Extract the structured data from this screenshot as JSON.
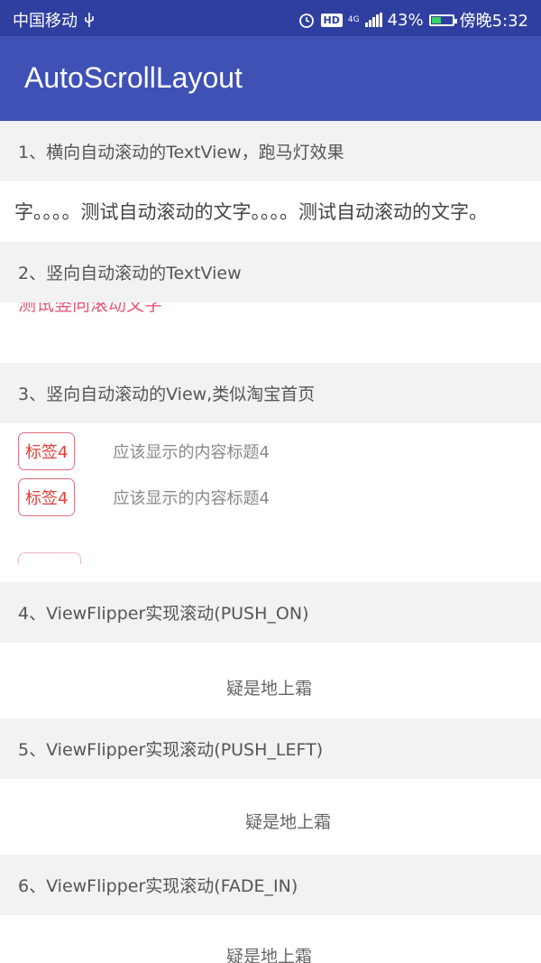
{
  "status_bar": {
    "carrier": "中国移动",
    "network": "4G",
    "battery": "43%",
    "time": "傍晚5:32",
    "battery_level": 0.43,
    "icons": [
      "usb-icon",
      "alarm-icon",
      "hd-icon",
      "signal-icon",
      "battery-icon"
    ]
  },
  "app": {
    "title": "AutoScrollLayout",
    "primary_color": "#3f51b5",
    "status_color": "#2f3f9f"
  },
  "sections": [
    {
      "header": "1、横向自动滚动的TextView，跑马灯效果",
      "marquee_text": "字。。。。测试自动滚动的文字。。。。测试自动滚动的文字。"
    },
    {
      "header": "2、竖向自动滚动的TextView",
      "partial_text": "测试竖向滚动文字"
    },
    {
      "header": "3、竖向自动滚动的View,类似淘宝首页",
      "items": [
        {
          "tag": "标签4",
          "title": "应该显示的内容标题4"
        },
        {
          "tag": "标签4",
          "title": "应该显示的内容标题4"
        }
      ]
    },
    {
      "header": "4、ViewFlipper实现滚动(PUSH_ON)",
      "text": "疑是地上霜"
    },
    {
      "header": "5、ViewFlipper实现滚动(PUSH_LEFT)",
      "text": "疑是地上霜"
    },
    {
      "header": "6、ViewFlipper实现滚动(FADE_IN)",
      "text": "疑是地上霜"
    }
  ]
}
